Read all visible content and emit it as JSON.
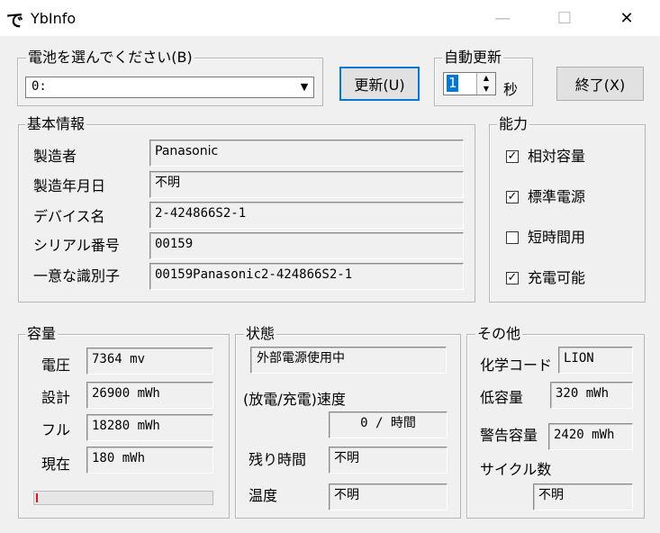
{
  "window": {
    "title": "YbInfo",
    "app_icon_glyph": "で",
    "minimize_glyph": "—",
    "maximize_glyph": "☐",
    "close_glyph": "✕"
  },
  "battery_select": {
    "legend": "電池を選んでください(B)",
    "value": "0:",
    "arrow": "▼"
  },
  "buttons": {
    "update": "更新(U)",
    "exit": "終了(X)"
  },
  "auto_update": {
    "legend": "自動更新",
    "value": "1",
    "unit": "秒",
    "up": "▲",
    "down": "▼"
  },
  "basic_info": {
    "legend": "基本情報",
    "rows": [
      {
        "label": "製造者",
        "value": "Panasonic"
      },
      {
        "label": "製造年月日",
        "value": "不明"
      },
      {
        "label": "デバイス名",
        "value": "2-424866S2-1"
      },
      {
        "label": "シリアル番号",
        "value": "00159"
      },
      {
        "label": "一意な識別子",
        "value": "00159Panasonic2-424866S2-1"
      }
    ]
  },
  "capability": {
    "legend": "能力",
    "items": [
      {
        "label": "相対容量",
        "checked": "✓"
      },
      {
        "label": "標準電源",
        "checked": "✓"
      },
      {
        "label": "短時間用",
        "checked": ""
      },
      {
        "label": "充電可能",
        "checked": "✓"
      }
    ]
  },
  "capacity": {
    "legend": "容量",
    "rows": [
      {
        "label": "電圧",
        "value": "7364 mv"
      },
      {
        "label": "設計",
        "value": "26900 mWh"
      },
      {
        "label": "フル",
        "value": "18280 mWh"
      },
      {
        "label": "現在",
        "value": "180 mWh"
      }
    ],
    "charge_fraction": 0.01,
    "bar_color": "#e81123"
  },
  "state": {
    "legend": "状態",
    "power": "外部電源使用中",
    "rate_label": "(放電/充電)速度",
    "rate_value": "0 / 時間",
    "remaining_label": "残り時間",
    "remaining_value": "不明",
    "temp_label": "温度",
    "temp_value": "不明"
  },
  "other": {
    "legend": "その他",
    "chem_label": "化学コード",
    "chem_value": "LION",
    "low_label": "低容量",
    "low_value": "320 mWh",
    "warn_label": "警告容量",
    "warn_value": "2420 mWh",
    "cycle_label": "サイクル数",
    "cycle_value": "不明"
  }
}
